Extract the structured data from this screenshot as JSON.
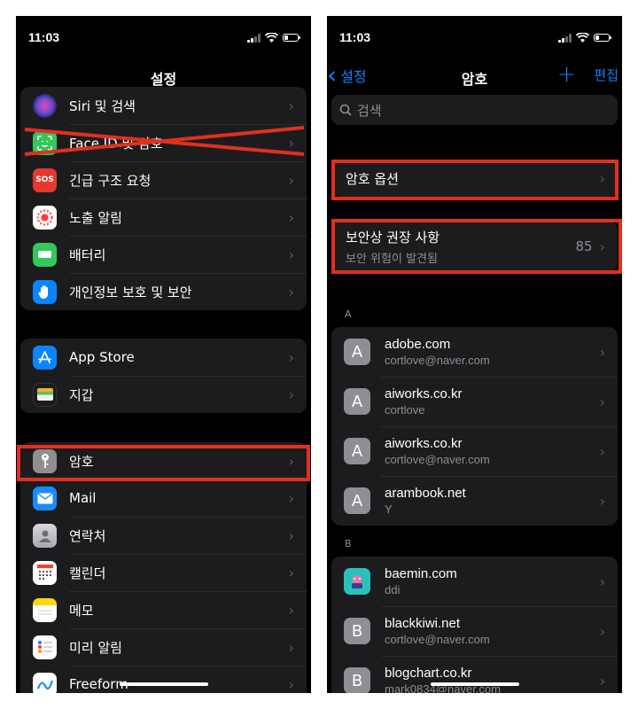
{
  "left": {
    "status_time": "11:03",
    "title": "설정",
    "group1": [
      {
        "label": "Siri 및 검색",
        "icon": "siri-icon",
        "color": "#3a3a8c"
      },
      {
        "label": "Face ID 및 암호",
        "icon": "face-id-icon",
        "color": "#34c759"
      },
      {
        "label": "긴급 구조 요청",
        "icon": "sos-icon",
        "icon_text": "SOS",
        "color": "#e5392f"
      },
      {
        "label": "노출 알림",
        "icon": "exposure-icon",
        "color": "#ffffff"
      },
      {
        "label": "배터리",
        "icon": "battery-icon",
        "color": "#34c759"
      },
      {
        "label": "개인정보 보호 및 보안",
        "icon": "hand-icon",
        "color": "#0a84ff"
      }
    ],
    "group2": [
      {
        "label": "App Store",
        "icon": "app-store-icon",
        "color": "#0a84ff"
      },
      {
        "label": "지갑",
        "icon": "wallet-icon",
        "color": "#1c1c1e"
      }
    ],
    "group3": [
      {
        "label": "암호",
        "icon": "key-icon",
        "color": "#8e8e93"
      },
      {
        "label": "Mail",
        "icon": "mail-icon",
        "color": "#0a84ff"
      },
      {
        "label": "연락처",
        "icon": "contacts-icon",
        "color": "#b0b0b5"
      },
      {
        "label": "캘린더",
        "icon": "calendar-icon",
        "color": "#ffffff"
      },
      {
        "label": "메모",
        "icon": "notes-icon",
        "color": "#ffd60a"
      },
      {
        "label": "미리 알림",
        "icon": "reminders-icon",
        "color": "#ffffff"
      },
      {
        "label": "Freeform",
        "icon": "freeform-icon",
        "color": "#ffffff"
      }
    ]
  },
  "right": {
    "status_time": "11:03",
    "back_label": "설정",
    "title": "암호",
    "edit_label": "편집",
    "search_placeholder": "검색",
    "option_label": "암호 옵션",
    "security": {
      "title": "보안상 권장 사항",
      "subtitle": "보안 위험이 발견됨",
      "count": "85"
    },
    "section_a": "A",
    "section_b": "B",
    "a_items": [
      {
        "domain": "adobe.com",
        "user": "cortlove@naver.com",
        "avatar": "A"
      },
      {
        "domain": "aiworks.co.kr",
        "user": "cortlove",
        "avatar": "A"
      },
      {
        "domain": "aiworks.co.kr",
        "user": "cortlove@naver.com",
        "avatar": "A"
      },
      {
        "domain": "arambook.net",
        "user": "Y",
        "avatar": "A"
      }
    ],
    "b_items": [
      {
        "domain": "baemin.com",
        "user": "ddi",
        "avatar": ""
      },
      {
        "domain": "blackkiwi.net",
        "user": "cortlove@naver.com",
        "avatar": "B"
      },
      {
        "domain": "blogchart.co.kr",
        "user": "mark0834@naver.com",
        "avatar": "B"
      }
    ]
  },
  "colors": {
    "annotation_red": "#e0301e",
    "ios_blue": "#0a84ff",
    "bg": "#000000",
    "cell": "#1c1c1e"
  }
}
